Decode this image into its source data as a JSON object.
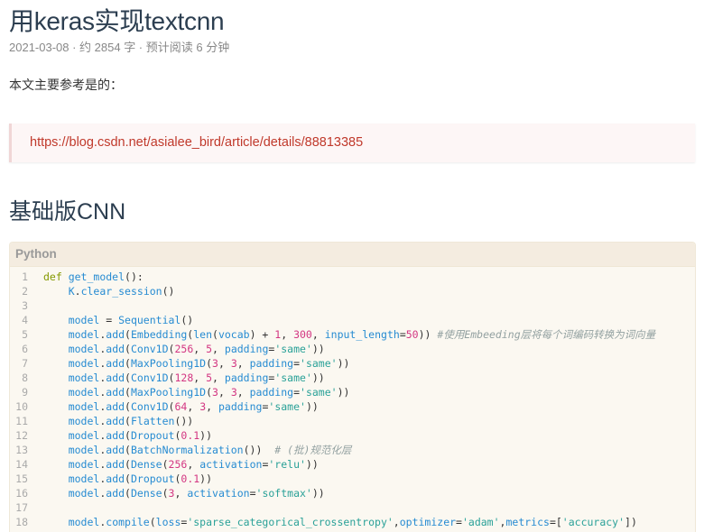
{
  "article": {
    "title": "用keras实现textcnn",
    "meta": "2021-03-08 · 约 2854 字 · 预计阅读 6 分钟",
    "intro": "本文主要参考是的：",
    "reference_link": "https://blog.csdn.net/asialee_bird/article/details/88813385",
    "section_heading": "基础版CNN"
  },
  "code_block": {
    "language": "Python",
    "lines": [
      {
        "n": "1",
        "tokens": [
          [
            "kw",
            "def "
          ],
          [
            "fn",
            "get_model"
          ],
          [
            "pun",
            "():"
          ]
        ]
      },
      {
        "n": "2",
        "tokens": [
          [
            "pun",
            "    "
          ],
          [
            "fn",
            "K"
          ],
          [
            "pun",
            "."
          ],
          [
            "fn",
            "clear_session"
          ],
          [
            "pun",
            "()"
          ]
        ]
      },
      {
        "n": "3",
        "tokens": []
      },
      {
        "n": "4",
        "tokens": [
          [
            "pun",
            "    "
          ],
          [
            "fn",
            "model"
          ],
          [
            "pun",
            " = "
          ],
          [
            "fn",
            "Sequential"
          ],
          [
            "pun",
            "()"
          ]
        ]
      },
      {
        "n": "5",
        "tokens": [
          [
            "pun",
            "    "
          ],
          [
            "fn",
            "model"
          ],
          [
            "pun",
            "."
          ],
          [
            "fn",
            "add"
          ],
          [
            "pun",
            "("
          ],
          [
            "fn",
            "Embedding"
          ],
          [
            "pun",
            "("
          ],
          [
            "fn",
            "len"
          ],
          [
            "pun",
            "("
          ],
          [
            "fn",
            "vocab"
          ],
          [
            "pun",
            ") + "
          ],
          [
            "num",
            "1"
          ],
          [
            "pun",
            ", "
          ],
          [
            "num",
            "300"
          ],
          [
            "pun",
            ", "
          ],
          [
            "fn",
            "input_length"
          ],
          [
            "pun",
            "="
          ],
          [
            "num",
            "50"
          ],
          [
            "pun",
            ")) "
          ],
          [
            "cmt",
            "#使用Embeeding层将每个词编码转换为词向量"
          ]
        ]
      },
      {
        "n": "6",
        "tokens": [
          [
            "pun",
            "    "
          ],
          [
            "fn",
            "model"
          ],
          [
            "pun",
            "."
          ],
          [
            "fn",
            "add"
          ],
          [
            "pun",
            "("
          ],
          [
            "fn",
            "Conv1D"
          ],
          [
            "pun",
            "("
          ],
          [
            "num",
            "256"
          ],
          [
            "pun",
            ", "
          ],
          [
            "num",
            "5"
          ],
          [
            "pun",
            ", "
          ],
          [
            "fn",
            "padding"
          ],
          [
            "pun",
            "="
          ],
          [
            "str",
            "'same'"
          ],
          [
            "pun",
            "))"
          ]
        ]
      },
      {
        "n": "7",
        "tokens": [
          [
            "pun",
            "    "
          ],
          [
            "fn",
            "model"
          ],
          [
            "pun",
            "."
          ],
          [
            "fn",
            "add"
          ],
          [
            "pun",
            "("
          ],
          [
            "fn",
            "MaxPooling1D"
          ],
          [
            "pun",
            "("
          ],
          [
            "num",
            "3"
          ],
          [
            "pun",
            ", "
          ],
          [
            "num",
            "3"
          ],
          [
            "pun",
            ", "
          ],
          [
            "fn",
            "padding"
          ],
          [
            "pun",
            "="
          ],
          [
            "str",
            "'same'"
          ],
          [
            "pun",
            "))"
          ]
        ]
      },
      {
        "n": "8",
        "tokens": [
          [
            "pun",
            "    "
          ],
          [
            "fn",
            "model"
          ],
          [
            "pun",
            "."
          ],
          [
            "fn",
            "add"
          ],
          [
            "pun",
            "("
          ],
          [
            "fn",
            "Conv1D"
          ],
          [
            "pun",
            "("
          ],
          [
            "num",
            "128"
          ],
          [
            "pun",
            ", "
          ],
          [
            "num",
            "5"
          ],
          [
            "pun",
            ", "
          ],
          [
            "fn",
            "padding"
          ],
          [
            "pun",
            "="
          ],
          [
            "str",
            "'same'"
          ],
          [
            "pun",
            "))"
          ]
        ]
      },
      {
        "n": "9",
        "tokens": [
          [
            "pun",
            "    "
          ],
          [
            "fn",
            "model"
          ],
          [
            "pun",
            "."
          ],
          [
            "fn",
            "add"
          ],
          [
            "pun",
            "("
          ],
          [
            "fn",
            "MaxPooling1D"
          ],
          [
            "pun",
            "("
          ],
          [
            "num",
            "3"
          ],
          [
            "pun",
            ", "
          ],
          [
            "num",
            "3"
          ],
          [
            "pun",
            ", "
          ],
          [
            "fn",
            "padding"
          ],
          [
            "pun",
            "="
          ],
          [
            "str",
            "'same'"
          ],
          [
            "pun",
            "))"
          ]
        ]
      },
      {
        "n": "10",
        "tokens": [
          [
            "pun",
            "    "
          ],
          [
            "fn",
            "model"
          ],
          [
            "pun",
            "."
          ],
          [
            "fn",
            "add"
          ],
          [
            "pun",
            "("
          ],
          [
            "fn",
            "Conv1D"
          ],
          [
            "pun",
            "("
          ],
          [
            "num",
            "64"
          ],
          [
            "pun",
            ", "
          ],
          [
            "num",
            "3"
          ],
          [
            "pun",
            ", "
          ],
          [
            "fn",
            "padding"
          ],
          [
            "pun",
            "="
          ],
          [
            "str",
            "'same'"
          ],
          [
            "pun",
            "))"
          ]
        ]
      },
      {
        "n": "11",
        "tokens": [
          [
            "pun",
            "    "
          ],
          [
            "fn",
            "model"
          ],
          [
            "pun",
            "."
          ],
          [
            "fn",
            "add"
          ],
          [
            "pun",
            "("
          ],
          [
            "fn",
            "Flatten"
          ],
          [
            "pun",
            "())"
          ]
        ]
      },
      {
        "n": "12",
        "tokens": [
          [
            "pun",
            "    "
          ],
          [
            "fn",
            "model"
          ],
          [
            "pun",
            "."
          ],
          [
            "fn",
            "add"
          ],
          [
            "pun",
            "("
          ],
          [
            "fn",
            "Dropout"
          ],
          [
            "pun",
            "("
          ],
          [
            "num",
            "0.1"
          ],
          [
            "pun",
            "))"
          ]
        ]
      },
      {
        "n": "13",
        "tokens": [
          [
            "pun",
            "    "
          ],
          [
            "fn",
            "model"
          ],
          [
            "pun",
            "."
          ],
          [
            "fn",
            "add"
          ],
          [
            "pun",
            "("
          ],
          [
            "fn",
            "BatchNormalization"
          ],
          [
            "pun",
            "())  "
          ],
          [
            "cmt",
            "# (批)规范化层"
          ]
        ]
      },
      {
        "n": "14",
        "tokens": [
          [
            "pun",
            "    "
          ],
          [
            "fn",
            "model"
          ],
          [
            "pun",
            "."
          ],
          [
            "fn",
            "add"
          ],
          [
            "pun",
            "("
          ],
          [
            "fn",
            "Dense"
          ],
          [
            "pun",
            "("
          ],
          [
            "num",
            "256"
          ],
          [
            "pun",
            ", "
          ],
          [
            "fn",
            "activation"
          ],
          [
            "pun",
            "="
          ],
          [
            "str",
            "'relu'"
          ],
          [
            "pun",
            "))"
          ]
        ]
      },
      {
        "n": "15",
        "tokens": [
          [
            "pun",
            "    "
          ],
          [
            "fn",
            "model"
          ],
          [
            "pun",
            "."
          ],
          [
            "fn",
            "add"
          ],
          [
            "pun",
            "("
          ],
          [
            "fn",
            "Dropout"
          ],
          [
            "pun",
            "("
          ],
          [
            "num",
            "0.1"
          ],
          [
            "pun",
            "))"
          ]
        ]
      },
      {
        "n": "16",
        "tokens": [
          [
            "pun",
            "    "
          ],
          [
            "fn",
            "model"
          ],
          [
            "pun",
            "."
          ],
          [
            "fn",
            "add"
          ],
          [
            "pun",
            "("
          ],
          [
            "fn",
            "Dense"
          ],
          [
            "pun",
            "("
          ],
          [
            "num",
            "3"
          ],
          [
            "pun",
            ", "
          ],
          [
            "fn",
            "activation"
          ],
          [
            "pun",
            "="
          ],
          [
            "str",
            "'softmax'"
          ],
          [
            "pun",
            "))"
          ]
        ]
      },
      {
        "n": "17",
        "tokens": []
      },
      {
        "n": "18",
        "tokens": [
          [
            "pun",
            "    "
          ],
          [
            "fn",
            "model"
          ],
          [
            "pun",
            "."
          ],
          [
            "fn",
            "compile"
          ],
          [
            "pun",
            "("
          ],
          [
            "fn",
            "loss"
          ],
          [
            "pun",
            "="
          ],
          [
            "str",
            "'sparse_categorical_crossentropy'"
          ],
          [
            "pun",
            ","
          ],
          [
            "fn",
            "optimizer"
          ],
          [
            "pun",
            "="
          ],
          [
            "str",
            "'adam'"
          ],
          [
            "pun",
            ","
          ],
          [
            "fn",
            "metrics"
          ],
          [
            "pun",
            "=["
          ],
          [
            "str",
            "'accuracy'"
          ],
          [
            "pun",
            "])"
          ]
        ]
      }
    ]
  }
}
